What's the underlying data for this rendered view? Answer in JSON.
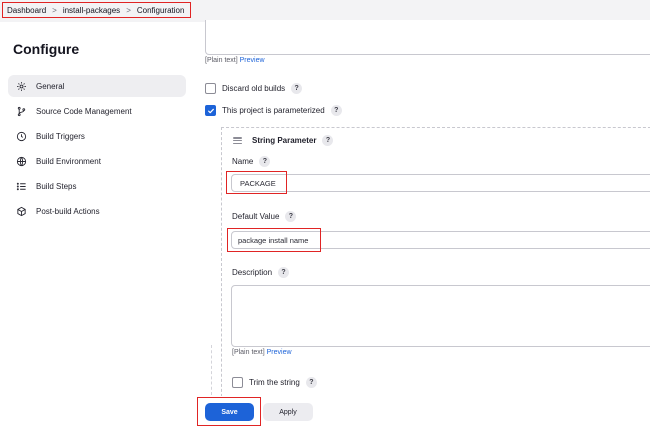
{
  "breadcrumb": {
    "items": [
      "Dashboard",
      "install-packages",
      "Configuration"
    ],
    "separator": ">"
  },
  "sidebar": {
    "title": "Configure",
    "items": [
      {
        "label": "General",
        "icon": "gear-icon",
        "active": true
      },
      {
        "label": "Source Code Management",
        "icon": "branch-icon"
      },
      {
        "label": "Build Triggers",
        "icon": "clock-icon"
      },
      {
        "label": "Build Environment",
        "icon": "globe-icon"
      },
      {
        "label": "Build Steps",
        "icon": "list-icon"
      },
      {
        "label": "Post-build Actions",
        "icon": "cube-icon"
      }
    ]
  },
  "general": {
    "plain_text_label": "[Plain text]",
    "preview_label": "Preview",
    "discard_old_builds": {
      "label": "Discard old builds",
      "checked": false
    },
    "parameterized": {
      "label": "This project is parameterized",
      "checked": true
    },
    "help_glyph": "?"
  },
  "string_parameter": {
    "title": "String Parameter",
    "name_label": "Name",
    "name_value": "PACKAGE",
    "default_value_label": "Default Value",
    "default_value": "package install name",
    "description_label": "Description",
    "description_value": "",
    "plain_text_label": "[Plain text]",
    "preview_label": "Preview",
    "trim_label": "Trim the string",
    "trim_checked": false
  },
  "footer": {
    "save_label": "Save",
    "apply_label": "Apply"
  },
  "colors": {
    "accent": "#1d63d8",
    "highlight": "#e02424"
  }
}
